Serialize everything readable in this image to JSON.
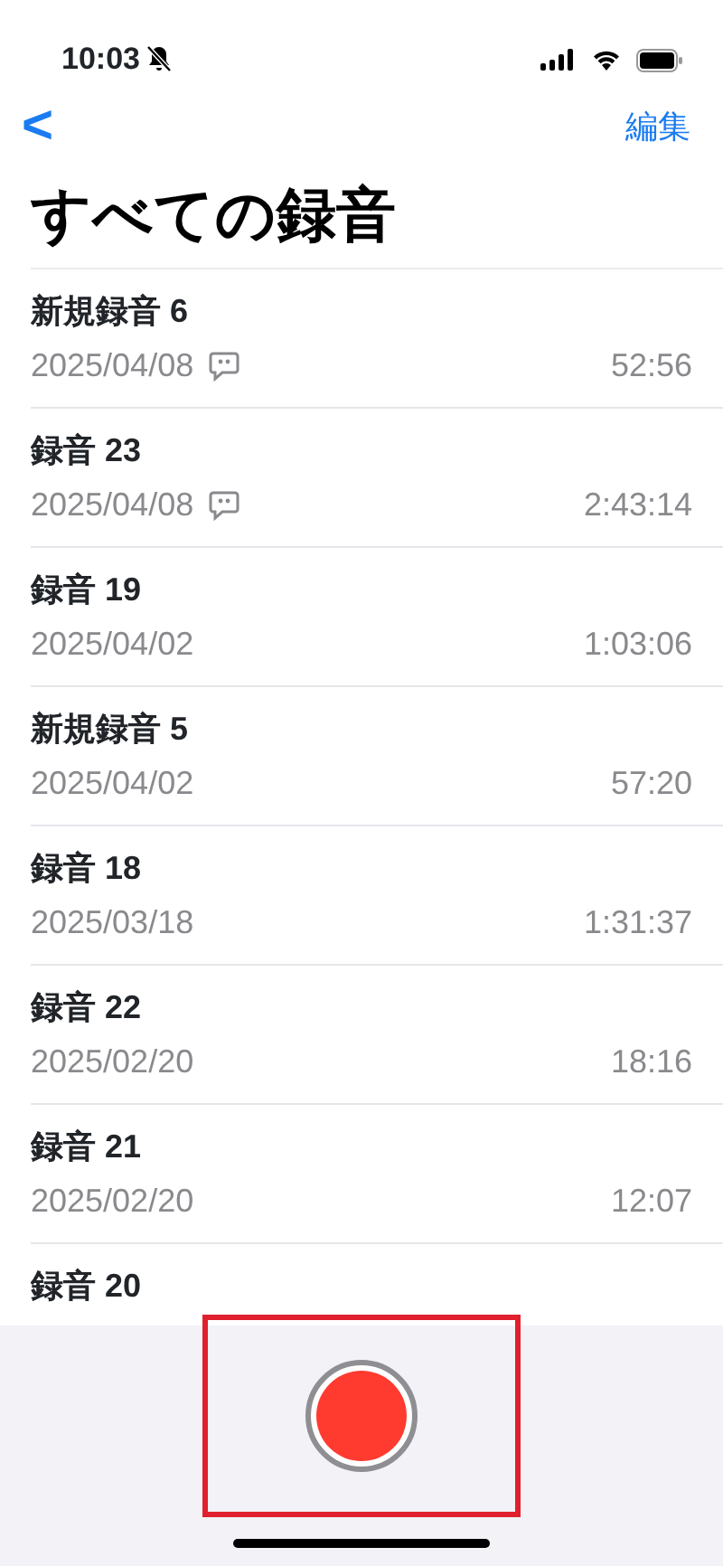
{
  "status_bar": {
    "time": "10:03",
    "silent": true
  },
  "nav": {
    "back": "<",
    "edit": "編集"
  },
  "title": "すべての録音",
  "recordings": [
    {
      "name": "新規録音 6",
      "date": "2025/04/08",
      "duration": "52:56",
      "transcript": true
    },
    {
      "name": "録音 23",
      "date": "2025/04/08",
      "duration": "2:43:14",
      "transcript": true
    },
    {
      "name": "録音 19",
      "date": "2025/04/02",
      "duration": "1:03:06",
      "transcript": false
    },
    {
      "name": "新規録音 5",
      "date": "2025/04/02",
      "duration": "57:20",
      "transcript": false
    },
    {
      "name": "録音 18",
      "date": "2025/03/18",
      "duration": "1:31:37",
      "transcript": false
    },
    {
      "name": "録音 22",
      "date": "2025/02/20",
      "duration": "18:16",
      "transcript": false
    },
    {
      "name": "録音 21",
      "date": "2025/02/20",
      "duration": "12:07",
      "transcript": false
    },
    {
      "name": "録音 20",
      "transcript": false
    }
  ],
  "record_button": {
    "highlighted": true
  }
}
